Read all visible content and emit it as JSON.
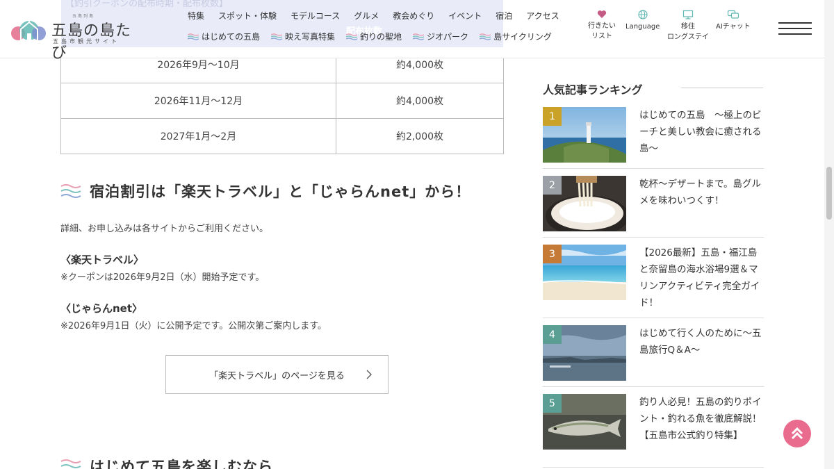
{
  "header": {
    "ghost_heading": "【釣引クーポンの配布時期・配布枚数】",
    "ghost_column": "配布枚数",
    "logo": {
      "title": "五島の島たび",
      "subtitle": "五島市観光サイト",
      "top_small": "五島列島"
    },
    "nav_primary": [
      "特集",
      "スポット・体験",
      "モデルコース",
      "グルメ",
      "教会めぐり",
      "イベント",
      "宿泊",
      "アクセス"
    ],
    "nav_secondary": [
      "はじめての五島",
      "映え写真特集",
      "釣りの聖地",
      "ジオパーク",
      "島サイクリング"
    ],
    "utility": {
      "wishlist": [
        "行きたい",
        "リスト"
      ],
      "language": "Language",
      "migration": [
        "移住",
        "ロングステイ"
      ],
      "ai_chat": "AIチャット"
    }
  },
  "coupon_table": {
    "rows": [
      {
        "period": "2026年9月〜10月",
        "count": "約4,000枚"
      },
      {
        "period": "2026年11月〜12月",
        "count": "約4,000枚"
      },
      {
        "period": "2027年1月〜2月",
        "count": "約2,000枚"
      }
    ]
  },
  "section": {
    "title": "宿泊割引は「楽天トラベル」と「じゃらんnet」から！",
    "intro": "詳細、お申し込みは各サイトからご利用ください。",
    "rakuten_heading": "〈楽天トラベル〉",
    "rakuten_note": "※クーポンは2026年9月2日（水）開始予定です。",
    "jalan_heading": "〈じゃらんnet〉",
    "jalan_note": "※2026年9月1日（火）に公開予定です。公開次第ご案内します。",
    "button_label": "「楽天トラベル」のページを見る",
    "next_title": "はじめて五島を楽しむなら"
  },
  "sidebar": {
    "title": "人気記事ランキング",
    "items": [
      {
        "rank": "1",
        "title": "はじめての五島　〜極上のビーチと美しい教会に癒される島〜",
        "badge_color": "#c9a227"
      },
      {
        "rank": "2",
        "title": "乾杯〜デザートまで。島グルメを味わいつくす！",
        "badge_color": "#9aa0a6"
      },
      {
        "rank": "3",
        "title": "【2026最新】五島・福江島と奈留島の海水浴場9選＆マリンアクティビティ完全ガイド！",
        "badge_color": "#c57a35"
      },
      {
        "rank": "4",
        "title": "はじめて行く人のために〜五島旅行Q＆A〜",
        "badge_color": "#5b9e94"
      },
      {
        "rank": "5",
        "title": "釣り人必見！五島の釣りポイント・釣れる魚を徹底解説！【五島市公式釣り特集】",
        "badge_color": "#5b9e94"
      }
    ]
  },
  "colors": {
    "accent_pink": "#e96b8e",
    "wave_pink": "#e8a0b4",
    "wave_teal": "#7fc3c0",
    "wave_blue": "#8fa8d8"
  }
}
